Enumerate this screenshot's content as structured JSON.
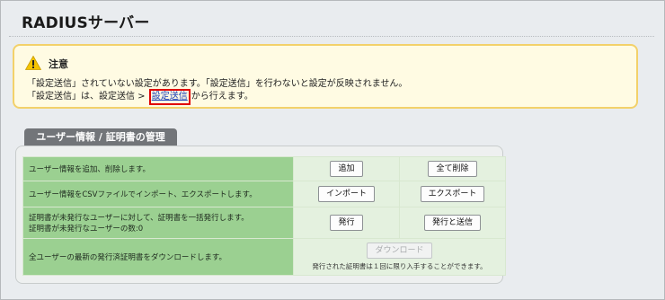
{
  "page": {
    "title": "RADIUSサーバー"
  },
  "notice": {
    "heading": "注意",
    "line1": "「設定送信」されていない設定があります。「設定送信」を行わないと設定が反映されません。",
    "line2_prefix": "「設定送信」は、設定送信 > ",
    "line2_link": "設定送信",
    "line2_suffix": "から行えます。",
    "icon": "warning-icon",
    "accent_color": "#f3d16a"
  },
  "section": {
    "tab_label": "ユーザー情報 / 証明書の管理",
    "rows": [
      {
        "desc": [
          "ユーザー情報を追加、削除します。"
        ],
        "btn1": "追加",
        "btn2": "全て削除"
      },
      {
        "desc": [
          "ユーザー情報をCSVファイルでインポート、エクスポートします。"
        ],
        "btn1": "インポート",
        "btn2": "エクスポート"
      },
      {
        "desc": [
          "証明書が未発行なユーザーに対して、証明書を一括発行します。",
          "証明書が未発行なユーザーの数:0"
        ],
        "btn1": "発行",
        "btn2": "発行と送信"
      },
      {
        "desc": [
          "全ユーザーの最新の発行済証明書をダウンロードします。"
        ],
        "btn1": "ダウンロード",
        "note": "発行された証明書は１回に限り入手することができます。"
      }
    ]
  },
  "colors": {
    "desc_cell": "#9bd091",
    "action_cell": "#e4f1df",
    "tab": "#727579",
    "highlight": "#e00000"
  }
}
